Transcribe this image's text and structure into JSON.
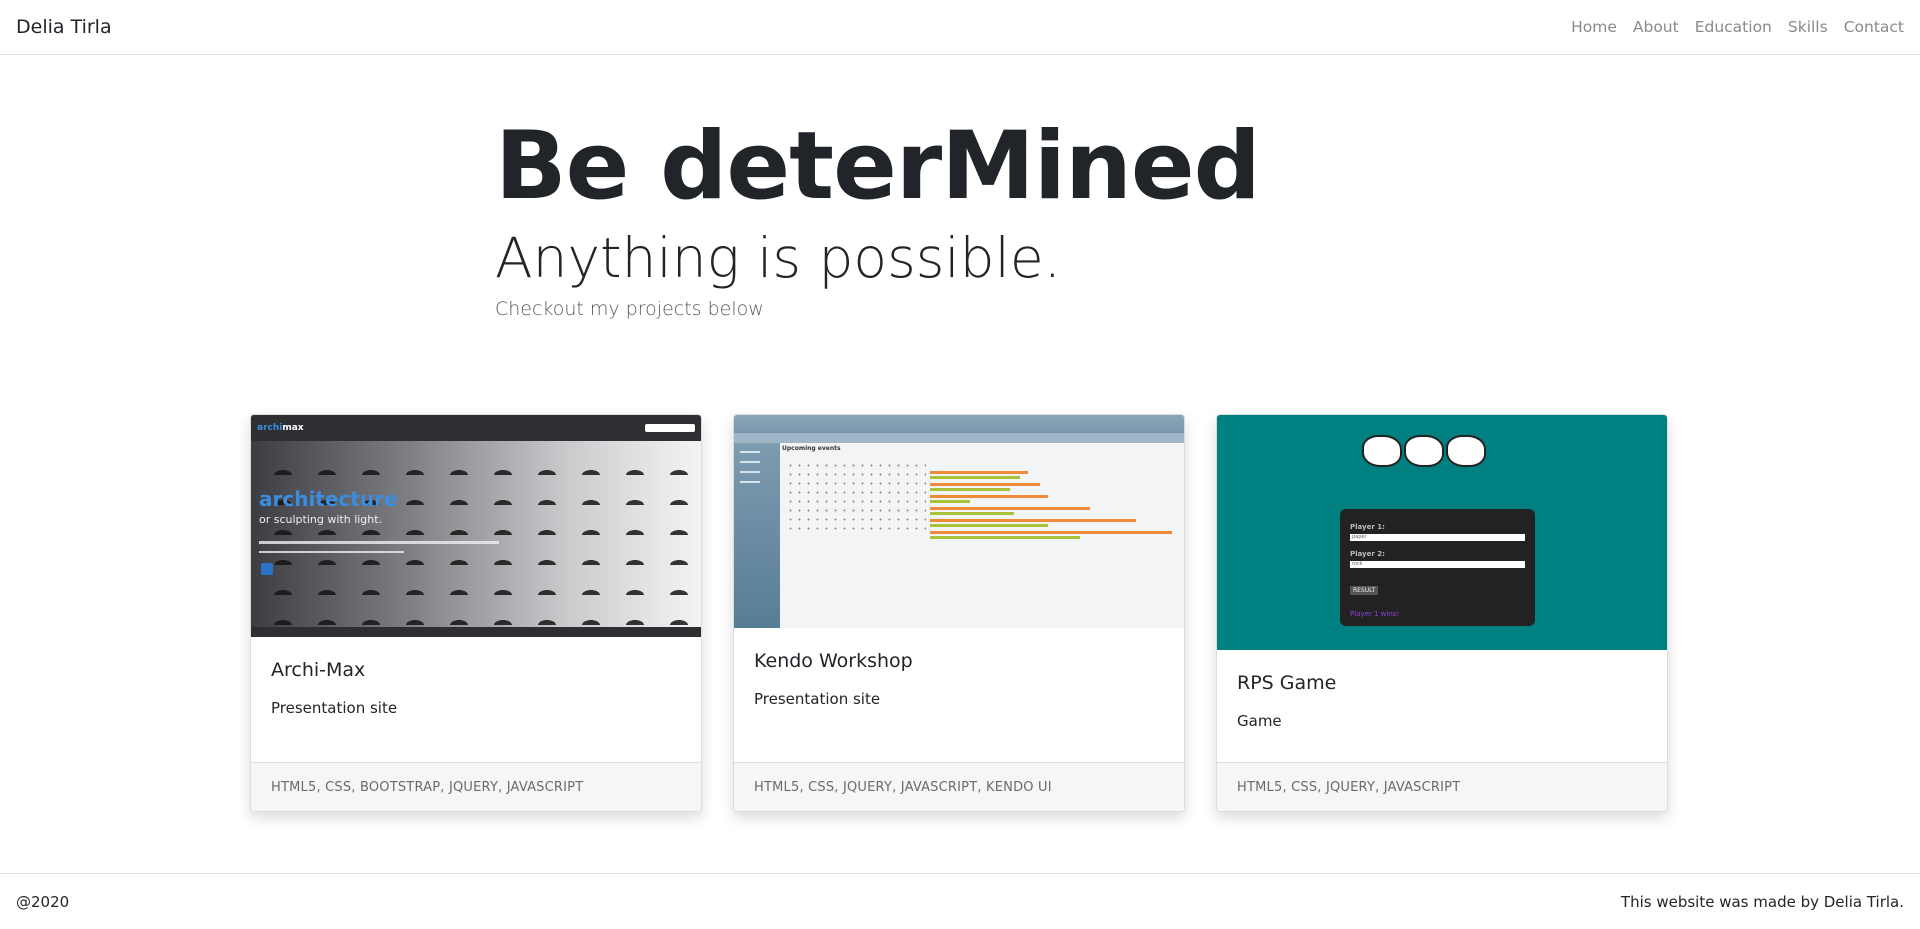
{
  "navbar": {
    "brand": "Delia Tirla",
    "links": [
      "Home",
      "About",
      "Education",
      "Skills",
      "Contact"
    ]
  },
  "hero": {
    "title": "Be deterMined",
    "subtitle": "Anything is possible.",
    "lead": "Checkout my projects below"
  },
  "cards": [
    {
      "title": "Archi-Max",
      "text": "Presentation site",
      "footer": "HTML5, CSS, BOOTSTRAP, JQUERY, JAVASCRIPT",
      "thumb": {
        "logo_a": "archi",
        "logo_b": "max",
        "heading": "architecture",
        "sub": "or sculpting with light."
      }
    },
    {
      "title": "Kendo Workshop",
      "text": "Presentation site",
      "footer": "HTML5, CSS, JQUERY, JAVASCRIPT, KENDO UI",
      "thumb": {
        "heading": "Upcoming events"
      }
    },
    {
      "title": "RPS Game",
      "text": "Game",
      "footer": "HTML5, CSS, JQUERY, JAVASCRIPT",
      "thumb": {
        "player1": "Player 1:",
        "player1_value": "paper",
        "player2": "Player 2:",
        "player2_value": "rock",
        "button": "RESULT",
        "result": "Player 1 wins!"
      }
    }
  ],
  "footer": {
    "left": "@2020",
    "right": "This website was made by Delia Tirla."
  }
}
